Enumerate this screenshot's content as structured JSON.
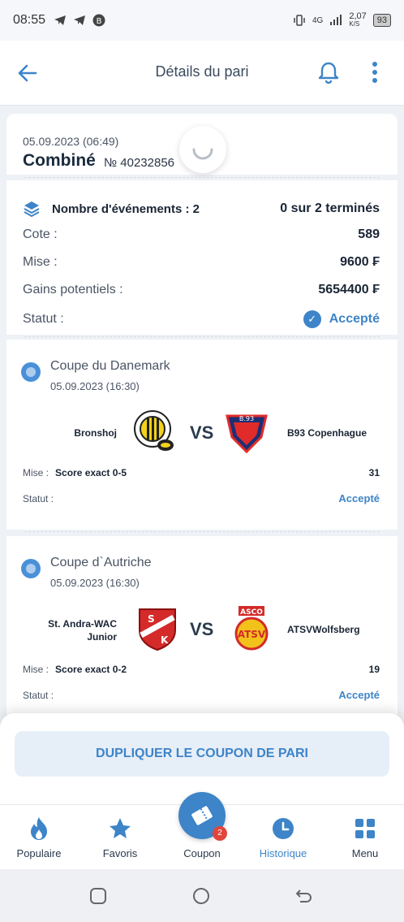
{
  "status_bar": {
    "time": "08:55",
    "network": "4G",
    "speed": "2,07",
    "speed_unit": "K/S",
    "battery": "93"
  },
  "header": {
    "title": "Détails du pari"
  },
  "bet": {
    "date": "05.09.2023 (06:49)",
    "type": "Combiné",
    "number": "№ 40232856"
  },
  "summary": {
    "events_label": "Nombre d'événements : 2",
    "progress": "0 sur 2 terminés",
    "cote_label": "Cote :",
    "cote_value": "589",
    "mise_label": "Mise :",
    "mise_value": "9600 ₣",
    "gains_label": "Gains potentiels :",
    "gains_value": "5654400 ₣",
    "statut_label": "Statut :",
    "statut_value": "Accepté"
  },
  "events": [
    {
      "competition": "Coupe du Danemark",
      "date": "05.09.2023 (16:30)",
      "home_team": "Bronshoj",
      "vs": "VS",
      "away_team": "B93 Copenhague",
      "mise_label": "Mise :",
      "pick": "Score exact 0-5",
      "odds": "31",
      "statut_label": "Statut :",
      "statut_value": "Accepté"
    },
    {
      "competition": "Coupe d`Autriche",
      "date": "05.09.2023 (16:30)",
      "home_team": "St. Andra-WAC Junior",
      "vs": "VS",
      "away_team": "ATSVWolfsberg",
      "mise_label": "Mise :",
      "pick": "Score exact 0-2",
      "odds": "19",
      "statut_label": "Statut :",
      "statut_value": "Accepté"
    }
  ],
  "actions": {
    "duplicate": "DUPLIQUER LE COUPON DE PARI"
  },
  "bottom_nav": {
    "items": [
      {
        "label": "Populaire",
        "icon": "flame-icon"
      },
      {
        "label": "Favoris",
        "icon": "star-icon"
      },
      {
        "label": "Coupon",
        "icon": "ticket-icon"
      },
      {
        "label": "Historique",
        "icon": "clock-icon"
      },
      {
        "label": "Menu",
        "icon": "grid-icon"
      }
    ],
    "coupon_badge": "2"
  },
  "colors": {
    "accent": "#3d84c8",
    "badge": "#e2453c",
    "text": "#1a2535"
  }
}
